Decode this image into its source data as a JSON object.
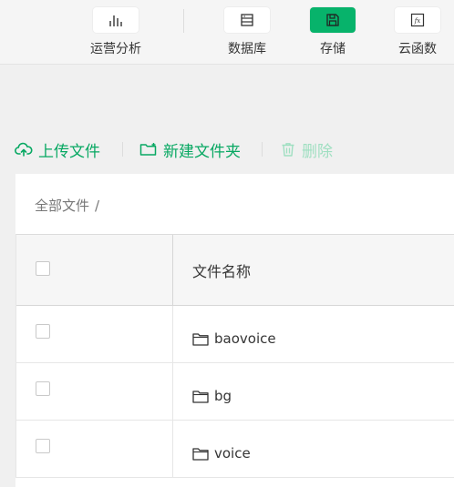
{
  "toolbar": {
    "items": [
      {
        "label": "运营分析",
        "icon": "bar-chart-icon",
        "active": false
      },
      {
        "label": "数据库",
        "icon": "database-icon",
        "active": false
      },
      {
        "label": "存储",
        "icon": "storage-icon",
        "active": true
      },
      {
        "label": "云函数",
        "icon": "function-icon",
        "active": false
      }
    ]
  },
  "actions": {
    "upload_label": "上传文件",
    "new_folder_label": "新建文件夹",
    "delete_label": "删除"
  },
  "breadcrumb": {
    "root": "全部文件",
    "separator": "/"
  },
  "table": {
    "header_name": "文件名称",
    "rows": [
      {
        "name": "baovoice",
        "type": "folder"
      },
      {
        "name": "bg",
        "type": "folder"
      },
      {
        "name": "voice",
        "type": "folder"
      }
    ]
  },
  "colors": {
    "accent": "#07b36b",
    "accent_text": "#07a862",
    "disabled": "#9fdfc1"
  }
}
